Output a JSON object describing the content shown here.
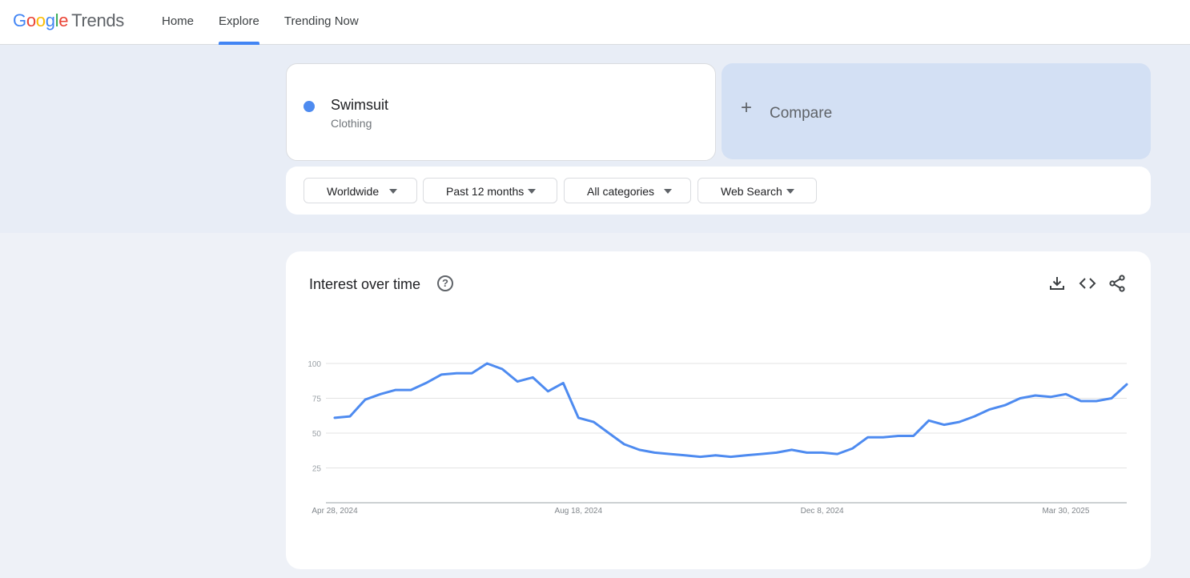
{
  "brand": {
    "letters": [
      "G",
      "o",
      "o",
      "g",
      "l",
      "e"
    ],
    "product": "Trends"
  },
  "nav": {
    "items": [
      {
        "label": "Home"
      },
      {
        "label": "Explore"
      },
      {
        "label": "Trending Now"
      }
    ],
    "active": "Explore"
  },
  "term": {
    "name": "Swimsuit",
    "category": "Clothing",
    "color": "#4e8bf0"
  },
  "compare": {
    "label": "Compare"
  },
  "filters": [
    {
      "label": "Worldwide"
    },
    {
      "label": "Past 12 months"
    },
    {
      "label": "All categories"
    },
    {
      "label": "Web Search"
    }
  ],
  "chart_section": {
    "title": "Interest over time",
    "help_icon": "help-circle-icon",
    "tools": [
      "download-icon",
      "embed-code-icon",
      "share-icon"
    ]
  },
  "chart_data": {
    "type": "line",
    "title": "",
    "xlabel": "",
    "ylabel": "",
    "ylim": [
      0,
      100
    ],
    "y_ticks": [
      25,
      50,
      75,
      100
    ],
    "x_tick_labels": [
      "Apr 28, 2024",
      "Aug 18, 2024",
      "Dec 8, 2024",
      "Mar 30, 2025"
    ],
    "x_tick_index": [
      0,
      16,
      32,
      48
    ],
    "grid": true,
    "series": [
      {
        "color": "#4e8bf0",
        "values": [
          61,
          62,
          74,
          78,
          81,
          81,
          86,
          92,
          93,
          93,
          100,
          96,
          87,
          90,
          80,
          86,
          61,
          58,
          50,
          42,
          38,
          36,
          35,
          34,
          33,
          34,
          33,
          34,
          35,
          36,
          38,
          36,
          36,
          35,
          39,
          47,
          47,
          48,
          48,
          59,
          56,
          58,
          62,
          67,
          70,
          75,
          77,
          76,
          78,
          73,
          73,
          75,
          85
        ]
      }
    ]
  }
}
